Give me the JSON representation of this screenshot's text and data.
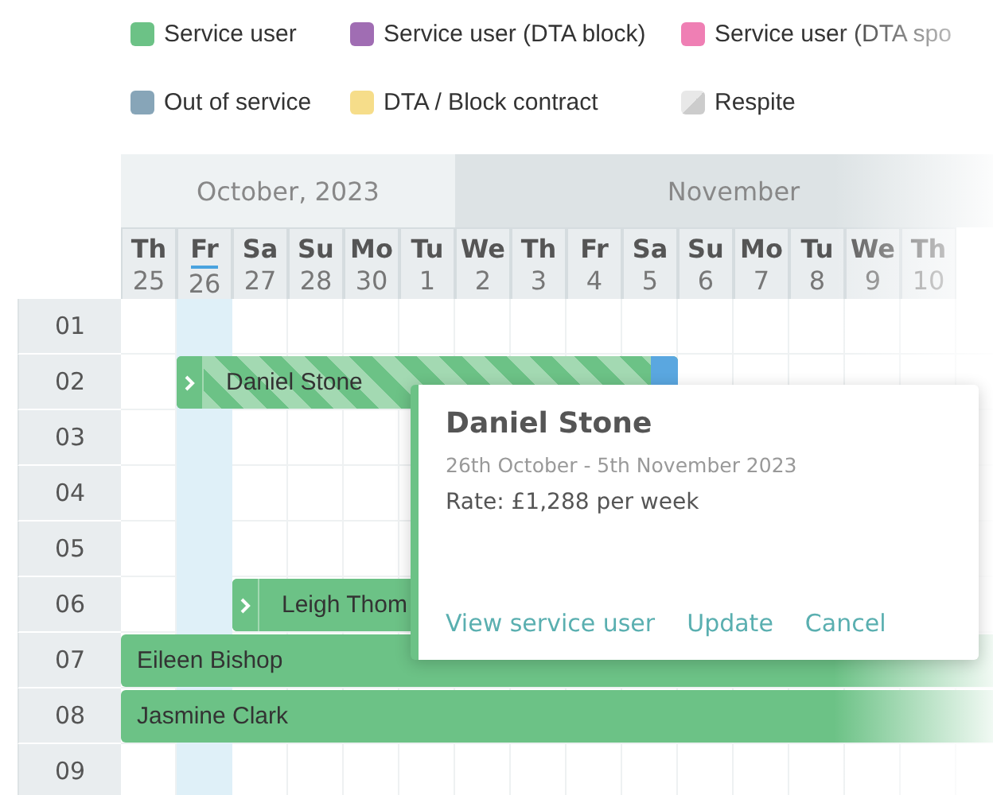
{
  "legend": [
    {
      "label": "Service user",
      "kind": "solid",
      "color": "#6cc286"
    },
    {
      "label": "Service user (DTA block)",
      "kind": "solid",
      "color": "#a06db3"
    },
    {
      "label": "Service user (DTA spo",
      "kind": "solid",
      "color": "#ef7fb4"
    },
    {
      "label": "Out of service",
      "kind": "solid",
      "color": "#87a5b8"
    },
    {
      "label": "DTA / Block contract",
      "kind": "solid",
      "color": "#f6dd8a"
    },
    {
      "label": "Respite",
      "kind": "split",
      "color": "#cccccc"
    }
  ],
  "months": [
    {
      "label": "October, 2023",
      "selected": true
    },
    {
      "label": "November",
      "selected": false
    }
  ],
  "days": [
    {
      "weekday": "Th",
      "date": "25",
      "today": false
    },
    {
      "weekday": "Fr",
      "date": "26",
      "today": true
    },
    {
      "weekday": "Sa",
      "date": "27",
      "today": false
    },
    {
      "weekday": "Su",
      "date": "28",
      "today": false
    },
    {
      "weekday": "Mo",
      "date": "30",
      "today": false
    },
    {
      "weekday": "Tu",
      "date": "1",
      "today": false
    },
    {
      "weekday": "We",
      "date": "2",
      "today": false
    },
    {
      "weekday": "Th",
      "date": "3",
      "today": false
    },
    {
      "weekday": "Fr",
      "date": "4",
      "today": false
    },
    {
      "weekday": "Sa",
      "date": "5",
      "today": false
    },
    {
      "weekday": "Su",
      "date": "6",
      "today": false
    },
    {
      "weekday": "Mo",
      "date": "7",
      "today": false
    },
    {
      "weekday": "Tu",
      "date": "8",
      "today": false
    },
    {
      "weekday": "We",
      "date": "9",
      "today": false
    },
    {
      "weekday": "Th",
      "date": "10",
      "today": false
    }
  ],
  "rooms": [
    "01",
    "02",
    "03",
    "04",
    "05",
    "06",
    "07",
    "08",
    "09"
  ],
  "bookings": [
    {
      "name": "Daniel Stone",
      "kind": "striped",
      "expand": true,
      "end_marker": true
    },
    {
      "name": "Leigh Thom",
      "kind": "solid",
      "expand": true,
      "end_marker": false
    },
    {
      "name": "Eileen Bishop",
      "kind": "solid",
      "expand": false,
      "end_marker": false
    },
    {
      "name": "Jasmine Clark",
      "kind": "solid",
      "expand": false,
      "end_marker": false
    }
  ],
  "popup": {
    "title": "Daniel Stone",
    "dates": "26th October - 5th November 2023",
    "rate": "Rate: £1,288 per week",
    "actions": [
      "View service user",
      "Update",
      "Cancel"
    ]
  }
}
